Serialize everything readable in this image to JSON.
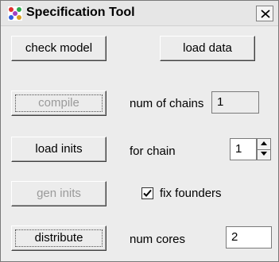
{
  "window": {
    "title": "Specification Tool",
    "icon": "specification-tool-app-icon",
    "close_icon": "close-icon"
  },
  "buttons": {
    "check_model": "check model",
    "load_data": "load data",
    "compile": "compile",
    "load_inits": "load inits",
    "gen_inits": "gen inits",
    "distribute": "distribute"
  },
  "fields": {
    "num_chains_label": "num of chains",
    "num_chains_value": "1",
    "for_chain_label": "for chain",
    "for_chain_value": "1",
    "fix_founders_label": "fix founders",
    "fix_founders_checked": true,
    "num_cores_label": "num cores",
    "num_cores_value": "2"
  },
  "states": {
    "compile_enabled": false,
    "gen_inits_enabled": false,
    "focused_button": "distribute"
  },
  "colors": {
    "window_bg": "#ececec",
    "disabled_text": "#9a9a9a",
    "titlebar_bg": "#e6e6e6"
  }
}
